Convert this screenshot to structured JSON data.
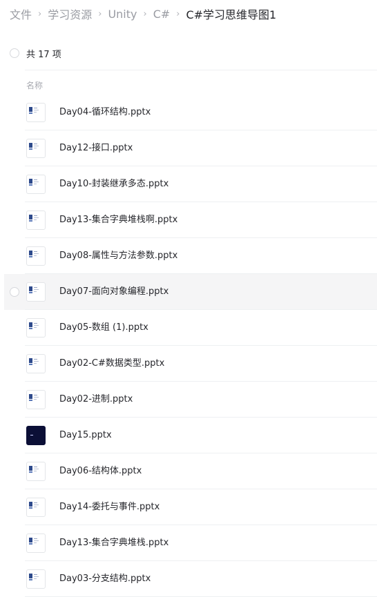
{
  "breadcrumb": {
    "items": [
      "文件",
      "学习资源",
      "Unity",
      "C#"
    ],
    "current": "C#学习思维导图1",
    "separator": "›"
  },
  "summary": {
    "count_label": "共 17 项"
  },
  "table": {
    "column_name": "名称"
  },
  "files": [
    {
      "name": "Day04-循环结构.pptx",
      "thumb": "slide"
    },
    {
      "name": "Day12-接口.pptx",
      "thumb": "slide"
    },
    {
      "name": "Day10-封装继承多态.pptx",
      "thumb": "slide"
    },
    {
      "name": "Day13-集合字典堆栈啊.pptx",
      "thumb": "slide"
    },
    {
      "name": "Day08-属性与方法参数.pptx",
      "thumb": "slide"
    },
    {
      "name": "Day07-面向对象编程.pptx",
      "thumb": "slide",
      "hovered": true
    },
    {
      "name": "Day05-数组 (1).pptx",
      "thumb": "slide"
    },
    {
      "name": "Day02-C#数据类型.pptx",
      "thumb": "slide"
    },
    {
      "name": "Day02-进制.pptx",
      "thumb": "slide"
    },
    {
      "name": "Day15.pptx",
      "thumb": "dark"
    },
    {
      "name": "Day06-结构体.pptx",
      "thumb": "slide"
    },
    {
      "name": "Day14-委托与事件.pptx",
      "thumb": "slide"
    },
    {
      "name": "Day13-集合字典堆栈.pptx",
      "thumb": "slide"
    },
    {
      "name": "Day03-分支结构.pptx",
      "thumb": "slide"
    }
  ],
  "colors": {
    "text": "#25262b",
    "muted": "#9a9ca3",
    "hover_bg": "#f5f5f6",
    "divider": "#eef0f2"
  }
}
